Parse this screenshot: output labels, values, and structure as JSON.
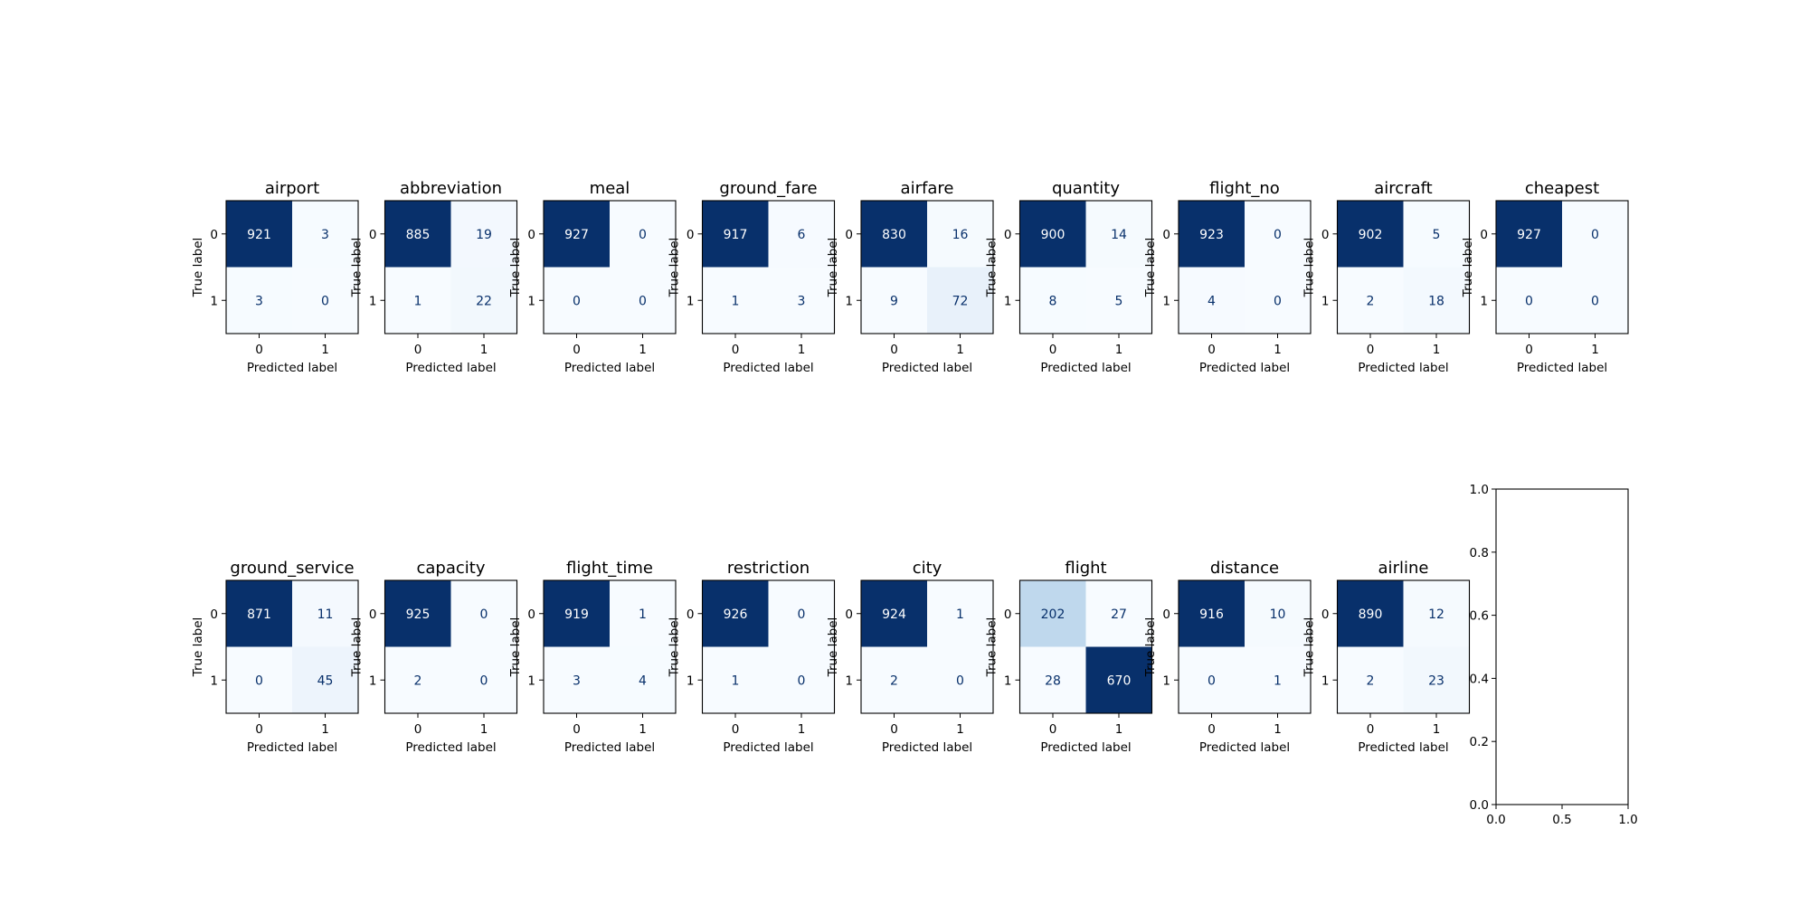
{
  "chart_data": {
    "type": "heatmap",
    "description": "Grid of binary confusion matrices, one per label",
    "colormap": "Blues",
    "xlabel": "Predicted label",
    "ylabel": "True label",
    "x_ticks": [
      "0",
      "1"
    ],
    "y_ticks": [
      "0",
      "1"
    ],
    "text_color_light": "#ffffff",
    "text_color_dark": "#08306b",
    "matrices": [
      {
        "title": "airport",
        "values": [
          [
            921,
            3
          ],
          [
            3,
            0
          ]
        ]
      },
      {
        "title": "abbreviation",
        "values": [
          [
            885,
            19
          ],
          [
            1,
            22
          ]
        ]
      },
      {
        "title": "meal",
        "values": [
          [
            927,
            0
          ],
          [
            0,
            0
          ]
        ]
      },
      {
        "title": "ground_fare",
        "values": [
          [
            917,
            6
          ],
          [
            1,
            3
          ]
        ]
      },
      {
        "title": "airfare",
        "values": [
          [
            830,
            16
          ],
          [
            9,
            72
          ]
        ]
      },
      {
        "title": "quantity",
        "values": [
          [
            900,
            14
          ],
          [
            8,
            5
          ]
        ]
      },
      {
        "title": "flight_no",
        "values": [
          [
            923,
            0
          ],
          [
            4,
            0
          ]
        ]
      },
      {
        "title": "aircraft",
        "values": [
          [
            902,
            5
          ],
          [
            2,
            18
          ]
        ]
      },
      {
        "title": "cheapest",
        "values": [
          [
            927,
            0
          ],
          [
            0,
            0
          ]
        ]
      },
      {
        "title": "ground_service",
        "values": [
          [
            871,
            11
          ],
          [
            0,
            45
          ]
        ]
      },
      {
        "title": "capacity",
        "values": [
          [
            925,
            0
          ],
          [
            2,
            0
          ]
        ]
      },
      {
        "title": "flight_time",
        "values": [
          [
            919,
            1
          ],
          [
            3,
            4
          ]
        ]
      },
      {
        "title": "restriction",
        "values": [
          [
            926,
            0
          ],
          [
            1,
            0
          ]
        ]
      },
      {
        "title": "city",
        "values": [
          [
            924,
            1
          ],
          [
            2,
            0
          ]
        ]
      },
      {
        "title": "flight",
        "values": [
          [
            202,
            27
          ],
          [
            28,
            670
          ]
        ]
      },
      {
        "title": "distance",
        "values": [
          [
            916,
            10
          ],
          [
            0,
            1
          ]
        ]
      },
      {
        "title": "airline",
        "values": [
          [
            890,
            12
          ],
          [
            2,
            23
          ]
        ]
      }
    ],
    "empty_axes": {
      "xlim": [
        0.0,
        1.0
      ],
      "ylim": [
        0.0,
        1.0
      ],
      "x_ticks": [
        "0.0",
        "0.5",
        "1.0"
      ],
      "y_ticks": [
        "0.0",
        "0.2",
        "0.4",
        "0.6",
        "0.8",
        "1.0"
      ]
    }
  }
}
